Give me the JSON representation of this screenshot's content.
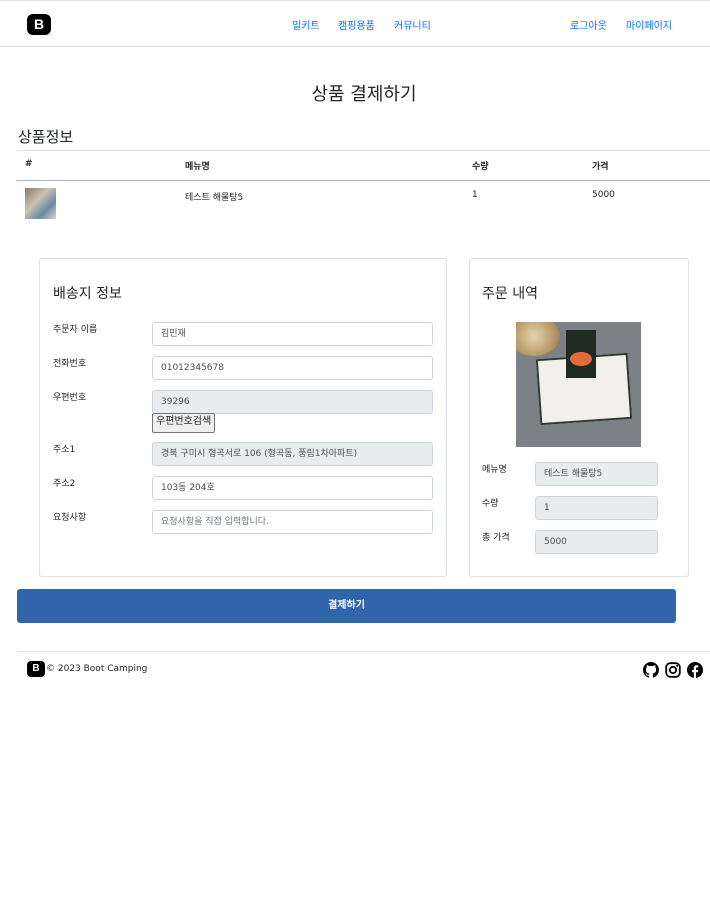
{
  "header": {
    "logo": "B",
    "nav": [
      "밀키트",
      "캠핑용품",
      "커뮤니티"
    ],
    "logout": "로그아웃",
    "mypage": "마이페이지"
  },
  "page_title": "상품 결제하기",
  "product_info": {
    "title": "상품정보",
    "columns": [
      "#",
      "메뉴명",
      "수량",
      "가격"
    ],
    "rows": [
      {
        "menu": "테스트 해물탕5",
        "qty": "1",
        "price": "5000"
      }
    ]
  },
  "shipping": {
    "title": "배송지 정보",
    "orderer_label": "주문자 이름",
    "orderer_value": "김민재",
    "phone_label": "전화번호",
    "phone_value": "01012345678",
    "zip_label": "우편번호",
    "zip_value": "39296",
    "zip_button": "우편번호검색",
    "addr1_label": "주소1",
    "addr1_value": "경북 구미시 형곡서로 106 (형곡동, 풍림1차아파트)",
    "addr2_label": "주소2",
    "addr2_value": "103동 204호",
    "request_label": "요청사항",
    "request_placeholder": "요청사항을 직접 입력합니다."
  },
  "order": {
    "title": "주문 내역",
    "menu_label": "메뉴명",
    "menu_value": "테스트 해물탕5",
    "qty_label": "수량",
    "qty_value": "1",
    "total_label": "총 가격",
    "total_value": "5000"
  },
  "pay_button": "결제하기",
  "footer": {
    "logo": "B",
    "copyright": "© 2023 Boot Camping",
    "icons": [
      "github-icon",
      "instagram-icon",
      "facebook-icon"
    ]
  },
  "colors": {
    "accent": "#0d6efd",
    "pay_button": "#3065ad",
    "readonly_bg": "#e9ecef"
  }
}
